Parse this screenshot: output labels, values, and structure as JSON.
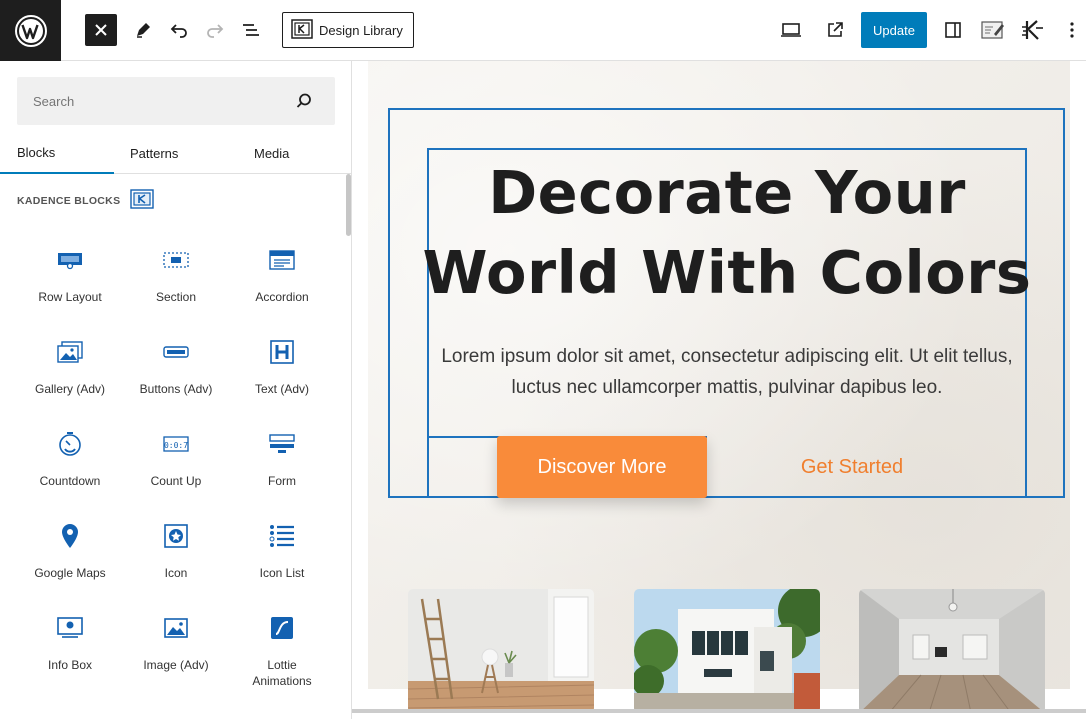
{
  "toolbar": {
    "design_library_label": "Design Library",
    "update_label": "Update",
    "icons": [
      "wordpress-logo",
      "close-icon",
      "pen-icon",
      "undo-icon",
      "redo-icon",
      "list-view-icon",
      "kadence-icon",
      "desktop-icon",
      "external-link-icon",
      "sidebar-toggle-icon",
      "edit-note-icon",
      "kadence-settings-icon",
      "more-options-icon"
    ]
  },
  "sidebar": {
    "search_placeholder": "Search",
    "tabs": [
      {
        "label": "Blocks",
        "active": true
      },
      {
        "label": "Patterns",
        "active": false
      },
      {
        "label": "Media",
        "active": false
      }
    ],
    "section_heading": "KADENCE BLOCKS",
    "blocks": [
      {
        "label": "Row Layout",
        "icon": "row-layout-icon"
      },
      {
        "label": "Section",
        "icon": "section-icon"
      },
      {
        "label": "Accordion",
        "icon": "accordion-icon"
      },
      {
        "label": "Gallery (Adv)",
        "icon": "gallery-icon"
      },
      {
        "label": "Buttons (Adv)",
        "icon": "buttons-icon"
      },
      {
        "label": "Text (Adv)",
        "icon": "heading-icon"
      },
      {
        "label": "Countdown",
        "icon": "countdown-icon"
      },
      {
        "label": "Count Up",
        "icon": "count-up-icon"
      },
      {
        "label": "Form",
        "icon": "form-icon"
      },
      {
        "label": "Google Maps",
        "icon": "map-pin-icon"
      },
      {
        "label": "Icon",
        "icon": "star-icon"
      },
      {
        "label": "Icon List",
        "icon": "icon-list-icon"
      },
      {
        "label": "Info Box",
        "icon": "info-box-icon"
      },
      {
        "label": "Image (Adv)",
        "icon": "image-icon"
      },
      {
        "label": "Lottie\nAnimations",
        "icon": "lottie-icon"
      }
    ]
  },
  "canvas": {
    "hero_title_line1": "Decorate Your",
    "hero_title_line2": "World With Colors",
    "hero_text_line1": "Lorem ipsum dolor sit amet, consectetur adipiscing elit. Ut elit tellus,",
    "hero_text_line2": "luctus nec ullamcorper mattis, pulvinar dapibus leo.",
    "primary_button": "Discover More",
    "secondary_button": "Get Started",
    "accent_color": "#f98b3a",
    "selection_color": "#1e73be",
    "thumbnails": [
      "empty-room-ladder",
      "white-modern-house",
      "empty-interior-room"
    ]
  }
}
